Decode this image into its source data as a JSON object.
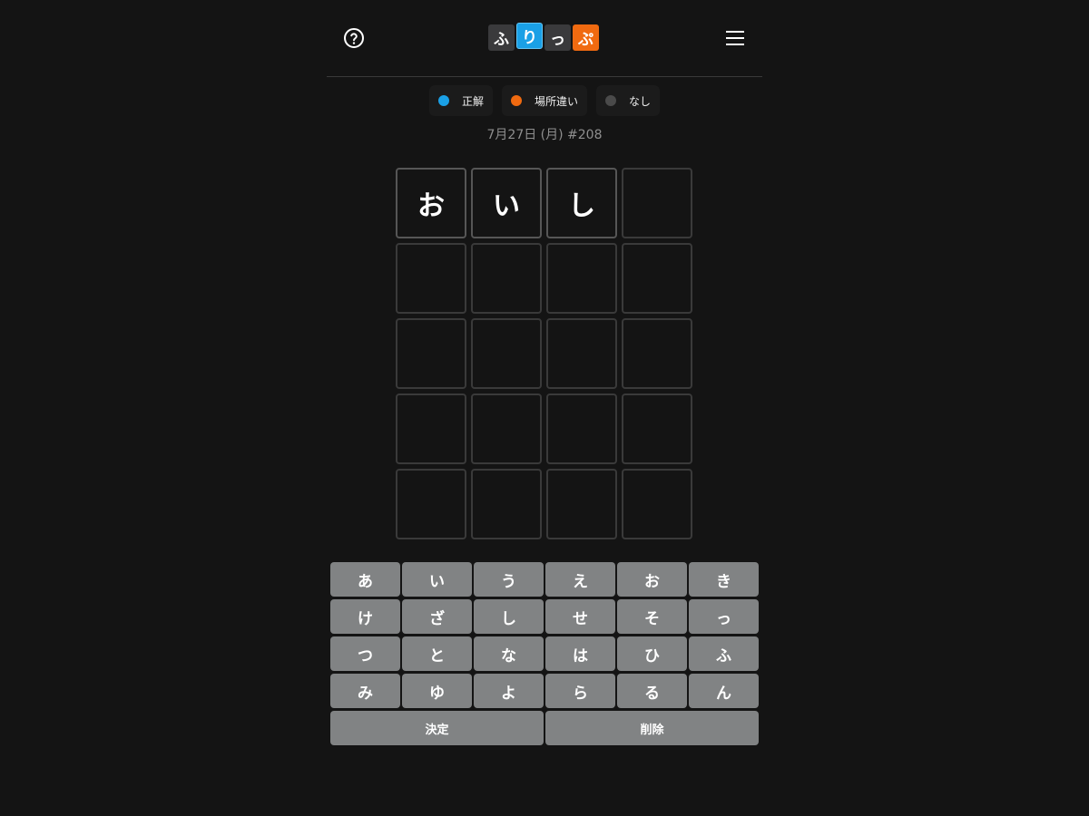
{
  "header": {
    "logo_letters": [
      "ふ",
      "り",
      "っ",
      "ぷ"
    ],
    "help_icon": "question-circle-icon",
    "menu_icon": "hamburger-menu-icon"
  },
  "legend": [
    {
      "label": "正解",
      "color": "#1aa0e6"
    },
    {
      "label": "場所違い",
      "color": "#f06a10"
    },
    {
      "label": "なし",
      "color": "#4a4a4a"
    }
  ],
  "date_line": "7月27日 (月) #208",
  "board": {
    "rows": [
      [
        "お",
        "い",
        "し",
        ""
      ],
      [
        "",
        "",
        "",
        ""
      ],
      [
        "",
        "",
        "",
        ""
      ],
      [
        "",
        "",
        "",
        ""
      ],
      [
        "",
        "",
        "",
        ""
      ]
    ]
  },
  "keyboard": {
    "keys": [
      "あ",
      "い",
      "う",
      "え",
      "お",
      "き",
      "け",
      "ざ",
      "し",
      "せ",
      "そ",
      "っ",
      "つ",
      "と",
      "な",
      "は",
      "ひ",
      "ふ",
      "み",
      "ゆ",
      "よ",
      "ら",
      "る",
      "ん"
    ],
    "enter_label": "決定",
    "delete_label": "削除"
  },
  "colors": {
    "background": "#141414",
    "key": "#818384",
    "correct": "#1aa0e6",
    "present": "#f06a10",
    "absent": "#4a4a4a"
  }
}
